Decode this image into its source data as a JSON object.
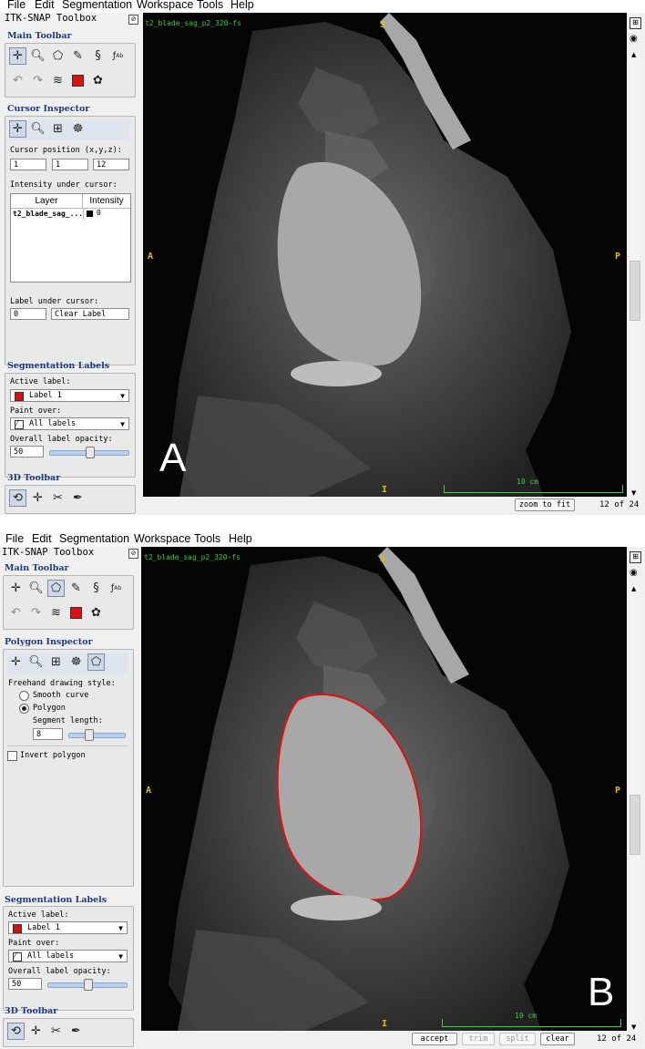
{
  "panels": [
    {
      "menu": [
        "File",
        "Edit",
        "Segmentation",
        "Workspace",
        "Tools",
        "Help"
      ],
      "toolbox_title": "ITK-SNAP Toolbox",
      "main_toolbar_title": "Main Toolbar",
      "inspector_title": "Cursor Inspector",
      "cursor_position_label": "Cursor position (x,y,z):",
      "cursor": [
        "1",
        "1",
        "12"
      ],
      "intensity_label": "Intensity under cursor:",
      "table_headers": [
        "Layer",
        "Intensity"
      ],
      "table_row": [
        "t2_blade_sag_...",
        "0"
      ],
      "label_under_cursor_label": "Label under cursor:",
      "label_under_cursor_value": "0",
      "label_under_cursor_name": "Clear Label",
      "seg_title": "Segmentation Labels",
      "active_label_label": "Active label:",
      "active_label": "Label 1",
      "paint_over_label": "Paint over:",
      "paint_over": "All labels",
      "opacity_label": "Overall label opacity:",
      "opacity": "50",
      "toolbar3d_title": "3D Toolbar",
      "image_name": "t2_blade_sag_p2_320-fs",
      "orient_top": "S",
      "orient_left": "A",
      "orient_right": "P",
      "orient_bottom": "I",
      "scale_text": "10 cm",
      "panel_letter": "A",
      "buttons": [
        "zoom to fit"
      ],
      "slice": "12 of 24"
    },
    {
      "menu": [
        "File",
        "Edit",
        "Segmentation",
        "Workspace",
        "Tools",
        "Help"
      ],
      "toolbox_title": "ITK-SNAP Toolbox",
      "main_toolbar_title": "Main Toolbar",
      "inspector_title": "Polygon Inspector",
      "freehand_label": "Freehand drawing style:",
      "smooth_label": "Smooth curve",
      "polygon_label": "Polygon",
      "segment_length_label": "Segment length:",
      "segment_length": "8",
      "invert_label": "Invert polygon",
      "seg_title": "Segmentation Labels",
      "active_label_label": "Active label:",
      "active_label": "Label 1",
      "paint_over_label": "Paint over:",
      "paint_over": "All labels",
      "opacity_label": "Overall label opacity:",
      "opacity": "50",
      "toolbar3d_title": "3D Toolbar",
      "image_name": "t2_blade_sag_p2_320-fs",
      "orient_top": "S",
      "orient_left": "A",
      "orient_right": "P",
      "orient_bottom": "I",
      "scale_text": "10 cm",
      "panel_letter": "B",
      "buttons": [
        "accept",
        "trim",
        "split",
        "clear"
      ],
      "slice": "12 of 24"
    }
  ],
  "colors": {
    "label_color": "#e01010",
    "polygon_outline": "#e01010",
    "orientation_text": "#e2c200",
    "overlay_text": "#30d030"
  },
  "opacity_fraction": 0.5,
  "segment_length_fraction": 0.35
}
